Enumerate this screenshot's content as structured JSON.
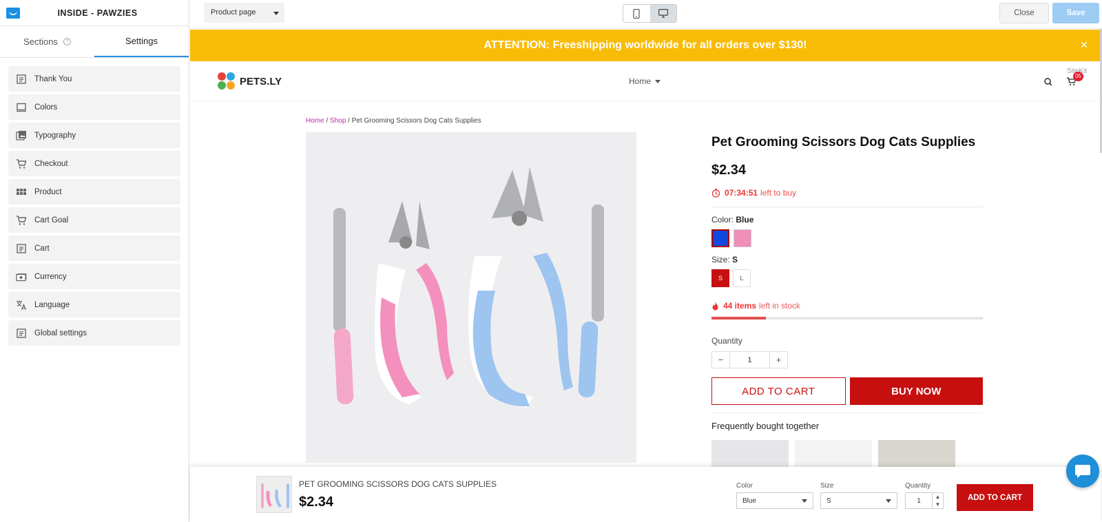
{
  "editor": {
    "title": "INSIDE - PAWZIES",
    "tabs": [
      {
        "label": "Sections"
      },
      {
        "label": "Settings"
      }
    ],
    "menu": [
      {
        "label": "Thank You",
        "icon": "document-icon"
      },
      {
        "label": "Colors",
        "icon": "monitor-icon"
      },
      {
        "label": "Typography",
        "icon": "image-icon"
      },
      {
        "label": "Checkout",
        "icon": "cart-icon"
      },
      {
        "label": "Product",
        "icon": "grid-icon"
      },
      {
        "label": "Cart Goal",
        "icon": "cart-icon"
      },
      {
        "label": "Cart",
        "icon": "document-icon"
      },
      {
        "label": "Currency",
        "icon": "money-icon"
      },
      {
        "label": "Language",
        "icon": "translate-icon"
      },
      {
        "label": "Global settings",
        "icon": "document-icon"
      }
    ]
  },
  "topbar": {
    "page_select": "Product page",
    "close_label": "Close",
    "save_label": "Save"
  },
  "store": {
    "announcement": "ATTENTION: Freeshipping worldwide for all orders over $130!",
    "logo_text": "PETS.LY",
    "nav_home": "Home",
    "sitekit": "SiteKit",
    "cart_count": "05"
  },
  "product": {
    "breadcrumb": {
      "home": "Home",
      "shop": "Shop",
      "current": "Pet Grooming Scissors Dog Cats Supplies"
    },
    "title": "Pet Grooming Scissors Dog Cats Supplies",
    "price": "$2.34",
    "timer": "07:34:51",
    "timer_suffix": "left to buy",
    "color_label": "Color:",
    "color_value": "Blue",
    "colors": [
      "#1049e0",
      "#f08fb8"
    ],
    "size_label": "Size:",
    "size_value": "S",
    "sizes": [
      "S",
      "L"
    ],
    "stock_count": "44 items",
    "stock_suffix": "left in stock",
    "stock_fraction": 0.2,
    "quantity_label": "Quantity",
    "quantity": "1",
    "add_to_cart": "ADD TO CART",
    "buy_now": "BUY NOW",
    "fbt_label": "Frequently bought together",
    "accent": "#c70f10"
  },
  "sticky": {
    "name": "PET GROOMING SCISSORS DOG CATS SUPPLIES",
    "price": "$2.34",
    "color_label": "Color",
    "color_value": "Blue",
    "size_label": "Size",
    "size_value": "S",
    "qty_label": "Quantity",
    "qty_value": "1",
    "add_label": "ADD TO CART"
  }
}
